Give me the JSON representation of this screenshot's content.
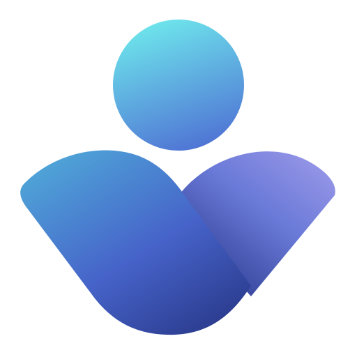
{
  "app_icon": {
    "icon_name": "person-icon",
    "colors": {
      "head_top": "#6ee7ec",
      "head_bottom": "#4f73d4",
      "left_wing_top": "#4fa6d8",
      "left_wing_bottom": "#2a3a8c",
      "right_wing_top": "#9a98e8",
      "right_wing_bottom": "#2f3f94",
      "background": "#ffffff"
    }
  }
}
